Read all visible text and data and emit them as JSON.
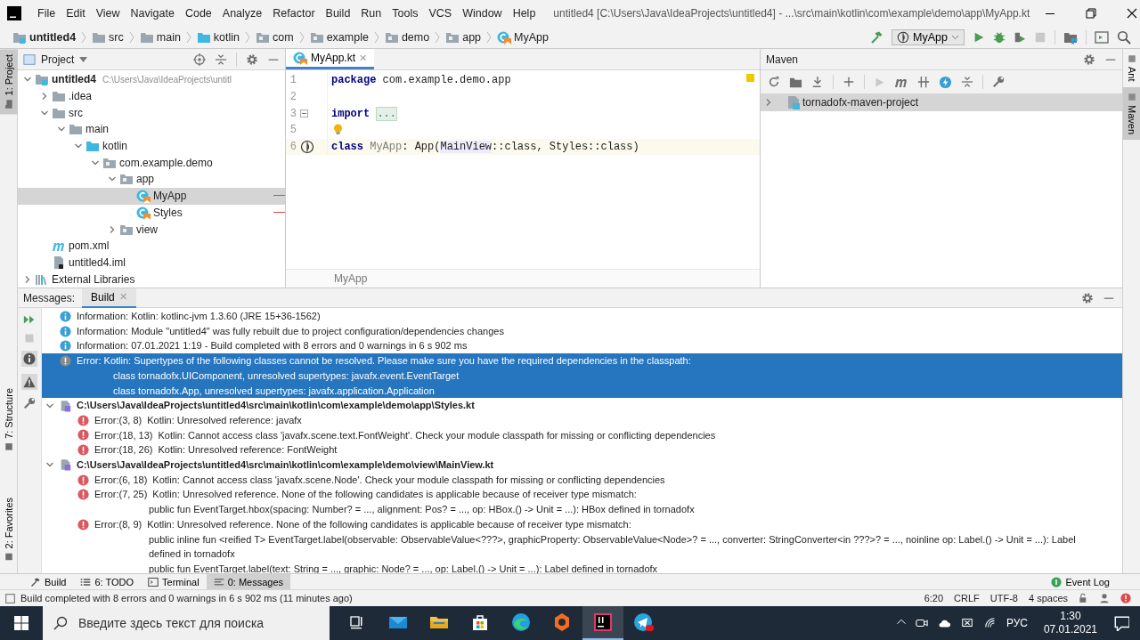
{
  "window": {
    "title": "untitled4 [C:\\Users\\Java\\IdeaProjects\\untitled4] - ...\\src\\main\\kotlin\\com\\example\\demo\\app\\MyApp.kt"
  },
  "menu": [
    "File",
    "Edit",
    "View",
    "Navigate",
    "Code",
    "Analyze",
    "Refactor",
    "Build",
    "Run",
    "Tools",
    "VCS",
    "Window",
    "Help"
  ],
  "breadcrumbs": [
    {
      "label": "untitled4",
      "kind": "module"
    },
    {
      "label": "src",
      "kind": "folder"
    },
    {
      "label": "main",
      "kind": "folder"
    },
    {
      "label": "kotlin",
      "kind": "source"
    },
    {
      "label": "com",
      "kind": "package"
    },
    {
      "label": "example",
      "kind": "package"
    },
    {
      "label": "demo",
      "kind": "package"
    },
    {
      "label": "app",
      "kind": "package"
    },
    {
      "label": "MyApp",
      "kind": "class"
    }
  ],
  "run_config": "MyApp",
  "left_stripe_top": [
    {
      "label": "1: Project",
      "selected": true
    }
  ],
  "left_stripe_bottom": [
    {
      "label": "7: Structure",
      "selected": false
    },
    {
      "label": "2: Favorites",
      "selected": false
    }
  ],
  "right_stripe": [
    {
      "label": "Ant",
      "selected": false
    },
    {
      "label": "Maven",
      "selected": true
    }
  ],
  "project": {
    "title": "Project",
    "tree": [
      {
        "label": "untitled4",
        "hint": "C:\\Users\\Java\\IdeaProjects\\untitl",
        "kind": "module",
        "expanded": true,
        "selected": false,
        "children": [
          {
            "label": ".idea",
            "kind": "folder",
            "expanded": false,
            "selected": false
          },
          {
            "label": "src",
            "kind": "folder",
            "expanded": true,
            "selected": false,
            "children": [
              {
                "label": "main",
                "kind": "folder",
                "expanded": true,
                "selected": false,
                "children": [
                  {
                    "label": "kotlin",
                    "kind": "source",
                    "expanded": true,
                    "selected": false,
                    "children": [
                      {
                        "label": "com.example.demo",
                        "kind": "package",
                        "expanded": true,
                        "selected": false,
                        "children": [
                          {
                            "label": "app",
                            "kind": "package",
                            "expanded": true,
                            "selected": false,
                            "children": [
                              {
                                "label": "MyApp",
                                "kind": "class",
                                "selected": true,
                                "error": true
                              },
                              {
                                "label": "Styles",
                                "kind": "class",
                                "selected": false,
                                "error": true
                              }
                            ]
                          },
                          {
                            "label": "view",
                            "kind": "package",
                            "expanded": false,
                            "selected": false
                          }
                        ]
                      }
                    ]
                  }
                ]
              }
            ]
          },
          {
            "label": "pom.xml",
            "kind": "maven",
            "selected": false
          },
          {
            "label": "untitled4.iml",
            "kind": "iml",
            "selected": false
          }
        ]
      },
      {
        "label": "External Libraries",
        "kind": "libraries",
        "expanded": false,
        "selected": false
      }
    ]
  },
  "editor": {
    "tabs": [
      {
        "label": "MyApp.kt",
        "close": "✕",
        "selected": true
      }
    ],
    "lines": [
      {
        "number": "1",
        "kind": "plain",
        "current": false,
        "tokens": [
          {
            "text": "package",
            "kind": "keyword"
          },
          {
            "text": " com.example.demo.app",
            "kind": "plain"
          }
        ]
      },
      {
        "number": "2",
        "kind": "plain",
        "current": false
      },
      {
        "number": "3",
        "kind": "fold",
        "current": false,
        "tokens": [
          {
            "text": "import",
            "kind": "keyword"
          },
          {
            "text": "...",
            "kind": "folded"
          }
        ]
      },
      {
        "number": "5",
        "kind": "bulb",
        "current": false
      },
      {
        "number": "6",
        "kind": "run",
        "current": true,
        "tokens": [
          {
            "text": "class",
            "kind": "keyword"
          },
          {
            "text": " MyApp",
            "kind": "unused"
          },
          {
            "text": ": App(",
            "kind": "plain"
          },
          {
            "text": "MainView",
            "kind": "highlight"
          },
          {
            "text": "::class, Styles::class)",
            "kind": "plain"
          }
        ]
      }
    ],
    "breadcrumb": "MyApp"
  },
  "maven": {
    "title": "Maven",
    "tree": [
      {
        "label": "tornadofx-maven-project",
        "expanded": false,
        "selected": true
      }
    ]
  },
  "messages": {
    "label": "Messages:",
    "tabs": [
      {
        "label": "Build",
        "close": "✕",
        "selected": true
      }
    ],
    "entries": [
      {
        "kind": "info",
        "text": "Information: Kotlin: kotlinc-jvm 1.3.60 (JRE 15+36-1562)",
        "selected": false
      },
      {
        "kind": "info",
        "text": "Information: Module \"untitled4\" was fully rebuilt due to project configuration/dependencies changes",
        "selected": false
      },
      {
        "kind": "info",
        "text": "Information: 07.01.2021 1:19 - Build completed with 8 errors and 0 warnings in 6 s 902 ms",
        "selected": false
      },
      {
        "kind": "error",
        "text": "Error: Kotlin: Supertypes of the following classes cannot be resolved. Please make sure you have the required dependencies in the classpath:",
        "details": [
          "class tornadofx.UIComponent, unresolved supertypes: javafx.event.EventTarget",
          "class tornadofx.App, unresolved supertypes: javafx.application.Application"
        ],
        "selected": true
      },
      {
        "kind": "file",
        "text": "C:\\Users\\Java\\IdeaProjects\\untitled4\\src\\main\\kotlin\\com\\example\\demo\\app\\Styles.kt",
        "expanded": true,
        "selected": false,
        "children": [
          {
            "location": "Error:(3, 8)",
            "text": "Kotlin: Unresolved reference: javafx",
            "selected": false
          },
          {
            "location": "Error:(18, 13)",
            "text": "Kotlin: Cannot access class 'javafx.scene.text.FontWeight'. Check your module classpath for missing or conflicting dependencies",
            "selected": false
          },
          {
            "location": "Error:(18, 26)",
            "text": "Kotlin: Unresolved reference: FontWeight",
            "selected": false
          }
        ]
      },
      {
        "kind": "file",
        "text": "C:\\Users\\Java\\IdeaProjects\\untitled4\\src\\main\\kotlin\\com\\example\\demo\\view\\MainView.kt",
        "expanded": true,
        "selected": false,
        "children": [
          {
            "location": "Error:(6, 18)",
            "text": "Kotlin: Cannot access class 'javafx.scene.Node'. Check your module classpath for missing or conflicting dependencies",
            "selected": false
          },
          {
            "location": "Error:(7, 25)",
            "text": "Kotlin: Unresolved reference. None of the following candidates is applicable because of receiver type mismatch:",
            "details": [
              "public fun EventTarget.hbox(spacing: Number? = ..., alignment: Pos? = ..., op: HBox.() -> Unit = ...): HBox defined in tornadofx"
            ],
            "selected": false
          },
          {
            "location": "Error:(8, 9)",
            "text": "Kotlin: Unresolved reference. None of the following candidates is applicable because of receiver type mismatch:",
            "details": [
              "public inline fun <reified T> EventTarget.label(observable: ObservableValue<???>, graphicProperty: ObservableValue<Node>? = ..., converter: StringConverter<in ???>? = ..., noinline op: Label.() -> Unit = ...): Label",
              "defined in tornadofx",
              "public fun EventTarget.label(text: String = ..., graphic: Node? = ..., op: Label.() -> Unit = ...): Label defined in tornadofx"
            ],
            "selected": false
          }
        ]
      }
    ]
  },
  "tool_windows": [
    {
      "label": "Build",
      "kind": "build",
      "selected": false
    },
    {
      "label": "6: TODO",
      "kind": "todo",
      "selected": false
    },
    {
      "label": "Terminal",
      "kind": "terminal",
      "selected": false
    },
    {
      "label": "0: Messages",
      "kind": "messages",
      "selected": true
    }
  ],
  "event_log": "Event Log",
  "status_bar": {
    "message": "Build completed with 8 errors and 0 warnings in 6 s 902 ms (11 minutes ago)",
    "items": [
      "6:20",
      "CRLF",
      "UTF-8",
      "4 spaces"
    ]
  },
  "taskbar": {
    "search": {
      "placeholder": "Введите здесь текст для поиска"
    },
    "apps": [
      {
        "kind": "taskview",
        "selected": false
      },
      {
        "kind": "mail",
        "selected": false
      },
      {
        "kind": "explorer",
        "selected": false
      },
      {
        "kind": "store",
        "selected": false
      },
      {
        "kind": "browser",
        "selected": false
      },
      {
        "kind": "player",
        "selected": false
      },
      {
        "kind": "ide",
        "selected": true
      },
      {
        "kind": "messenger",
        "selected": false
      }
    ],
    "language": "РУС",
    "time": "1:30",
    "date": "07.01.2021"
  }
}
